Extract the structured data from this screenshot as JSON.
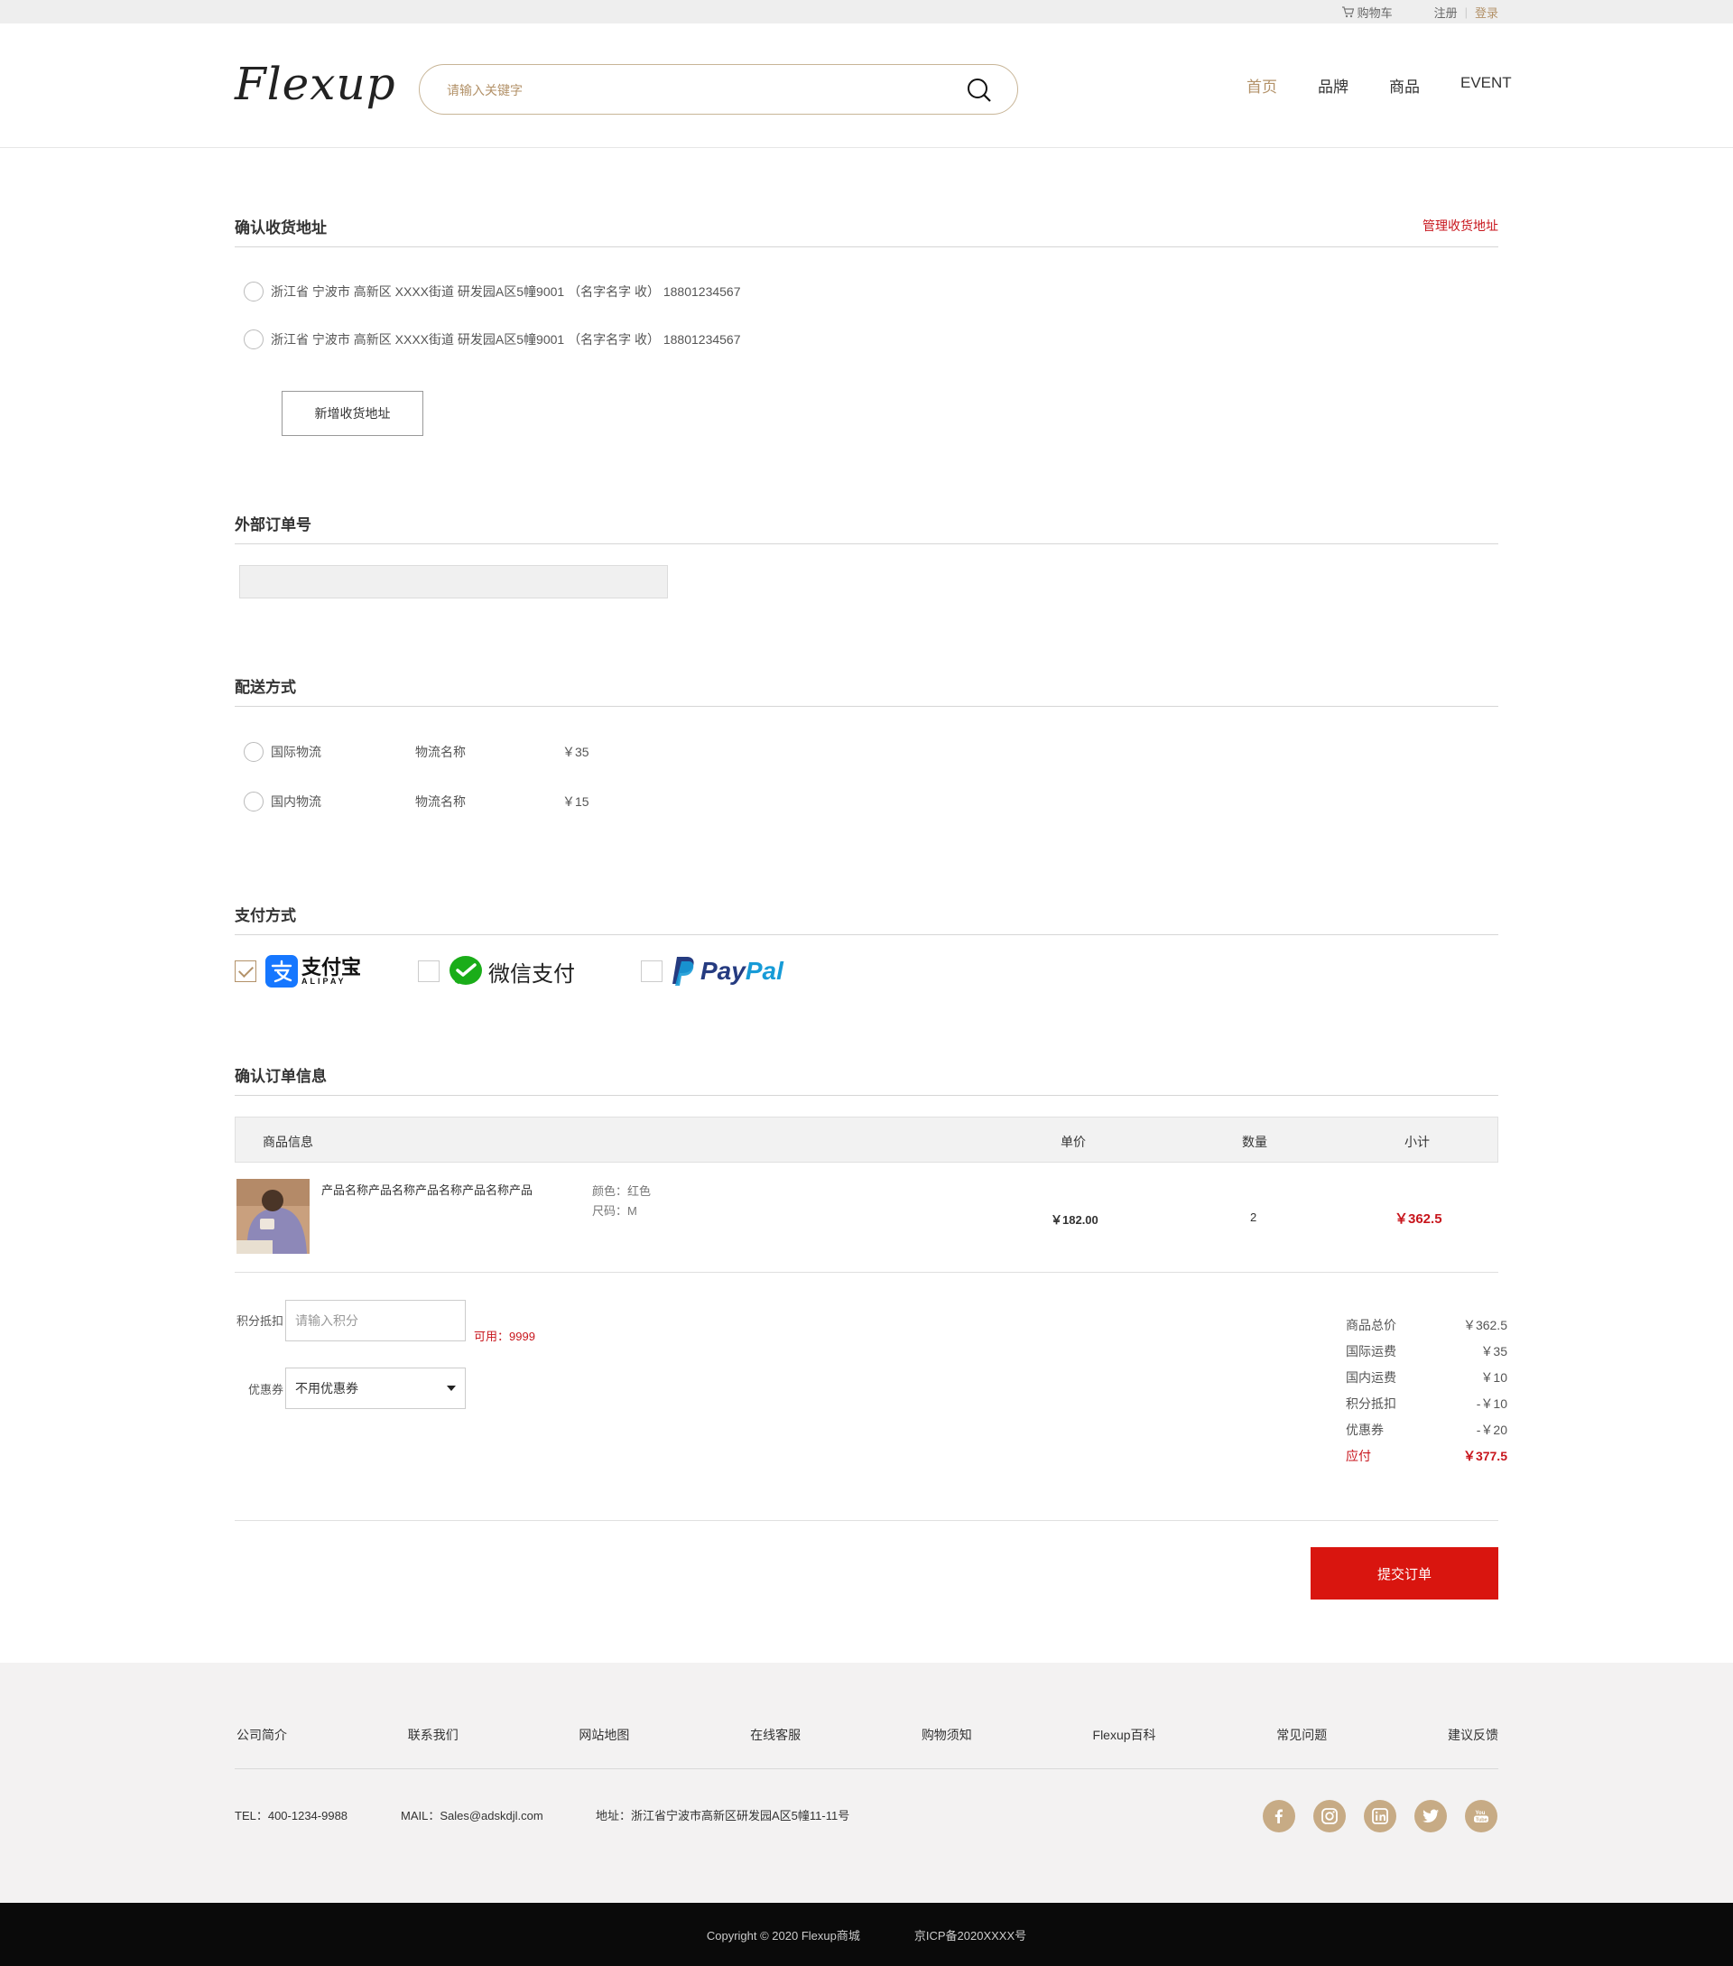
{
  "topbar": {
    "cart": "购物车",
    "register": "注册",
    "separator": "|",
    "login": "登录"
  },
  "header": {
    "logo": "Flexup",
    "search_placeholder": "请输入关键字",
    "nav": [
      "首页",
      "品牌",
      "商品",
      "EVENT"
    ]
  },
  "address": {
    "title": "确认收货地址",
    "manage": "管理收货地址",
    "items": [
      "浙江省 宁波市 高新区 XXXX街道 研发园A区5幢9001 （名字名字 收） 18801234567",
      "浙江省 宁波市 高新区 XXXX街道 研发园A区5幢9001 （名字名字 收） 18801234567"
    ],
    "add_button": "新增收货地址"
  },
  "external_order": {
    "title": "外部订单号",
    "value": ""
  },
  "shipping": {
    "title": "配送方式",
    "options": [
      {
        "name": "国际物流",
        "carrier": "物流名称",
        "price": "￥35"
      },
      {
        "name": "国内物流",
        "carrier": "物流名称",
        "price": "￥15"
      }
    ]
  },
  "payment": {
    "title": "支付方式",
    "alipay": {
      "cn": "支付宝",
      "en": "ALIPAY",
      "checked": true
    },
    "wechat": {
      "label": "微信支付",
      "checked": false
    },
    "paypal": {
      "pay": "Pay",
      "pal": "Pal",
      "checked": false
    }
  },
  "order": {
    "title": "确认订单信息",
    "headers": {
      "info": "商品信息",
      "price": "单价",
      "qty": "数量",
      "subtotal": "小计"
    },
    "item": {
      "name": "产品名称产品名称产品名称产品名称产品",
      "color": "颜色：红色",
      "size": "尺码：M",
      "price": "￥182.00",
      "qty": "2",
      "subtotal": "￥362.5"
    }
  },
  "discount": {
    "points_label": "积分抵扣",
    "points_placeholder": "请输入积分",
    "available": "可用：9999",
    "coupon_label": "优惠券",
    "coupon_value": "不用优惠券"
  },
  "summary": [
    {
      "label": "商品总价",
      "value": "￥362.5"
    },
    {
      "label": "国际运费",
      "value": "￥35"
    },
    {
      "label": "国内运费",
      "value": "￥10"
    },
    {
      "label": "积分抵扣",
      "value": "-￥10"
    },
    {
      "label": "优惠券",
      "value": "-￥20"
    },
    {
      "label": "应付",
      "value": "￥377.5"
    }
  ],
  "submit": "提交订单",
  "footer": {
    "links": [
      "公司简介",
      "联系我们",
      "网站地图",
      "在线客服",
      "购物须知",
      "Flexup百科",
      "常见问题",
      "建议反馈"
    ],
    "tel": "TEL：400-1234-9988",
    "mail": "MAIL：Sales@adskdjl.com",
    "address": "地址：浙江省宁波市高新区研发园A区5幢11-11号",
    "social": [
      "facebook-icon",
      "instagram-icon",
      "linkedin-icon",
      "twitter-icon",
      "youtube-icon"
    ],
    "copyright": "Copyright © 2020 Flexup商城",
    "icp": "京ICP备2020XXXX号"
  },
  "colors": {
    "accent": "#b39269",
    "red": "#c8161d",
    "submit": "#d9150f",
    "social": "#c7ab85"
  }
}
